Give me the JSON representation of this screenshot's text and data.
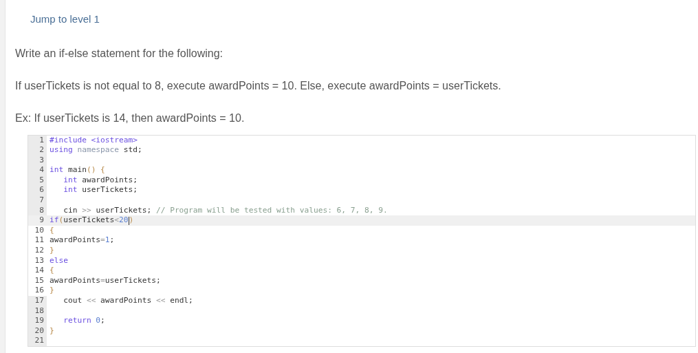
{
  "jump_link": "Jump to level 1",
  "instructions": [
    "Write an if-else statement for the following:",
    "If userTickets is not equal to 8, execute awardPoints = 10. Else, execute awardPoints = userTickets.",
    "Ex: If userTickets is 14, then awardPoints = 10."
  ],
  "code_editor": {
    "lines": [
      {
        "number": "1",
        "editable": false,
        "current": false,
        "tokens": [
          {
            "kind": "meta",
            "text": "#include <iostream>"
          }
        ]
      },
      {
        "number": "2",
        "editable": false,
        "current": false,
        "tokens": [
          {
            "kind": "keyword",
            "text": "using "
          },
          {
            "kind": "ns",
            "text": "namespace"
          },
          {
            "kind": "plain",
            "text": " std;"
          }
        ]
      },
      {
        "number": "3",
        "editable": false,
        "current": false
      },
      {
        "number": "4",
        "editable": false,
        "current": false,
        "tokens": [
          {
            "kind": "keyword",
            "text": "int"
          },
          {
            "kind": "plain",
            "text": " main"
          },
          {
            "kind": "bracket",
            "text": "() {"
          }
        ]
      },
      {
        "number": "5",
        "editable": false,
        "current": false,
        "tokens": [
          {
            "kind": "keyword",
            "text": "   int"
          },
          {
            "kind": "plain",
            "text": " awardPoints;"
          }
        ]
      },
      {
        "number": "6",
        "editable": false,
        "current": false,
        "tokens": [
          {
            "kind": "keyword",
            "text": "   int"
          },
          {
            "kind": "plain",
            "text": " userTickets;"
          }
        ]
      },
      {
        "number": "7",
        "editable": false,
        "current": false
      },
      {
        "number": "8",
        "editable": false,
        "current": false,
        "tokens": [
          {
            "kind": "plain",
            "text": "   cin "
          },
          {
            "kind": "operator",
            "text": ">>"
          },
          {
            "kind": "plain",
            "text": " userTickets; "
          },
          {
            "kind": "comment",
            "text": "// Program will be tested with values: 6, 7, 8, 9."
          }
        ]
      },
      {
        "number": "9",
        "editable": true,
        "current": true,
        "tokens": [
          {
            "kind": "keyword",
            "text": "if"
          },
          {
            "kind": "bracket",
            "text": "("
          },
          {
            "kind": "plain",
            "text": "userTickets"
          },
          {
            "kind": "operator",
            "text": "<"
          },
          {
            "kind": "number",
            "text": "20"
          },
          {
            "kind": "bracket",
            "text": ")"
          }
        ]
      },
      {
        "number": "10",
        "editable": true,
        "current": false,
        "tokens": [
          {
            "kind": "bracket",
            "text": "{"
          }
        ]
      },
      {
        "number": "11",
        "editable": true,
        "current": false,
        "tokens": [
          {
            "kind": "plain",
            "text": "awardPoints"
          },
          {
            "kind": "operator",
            "text": "="
          },
          {
            "kind": "number",
            "text": "1"
          },
          {
            "kind": "plain",
            "text": ";"
          }
        ]
      },
      {
        "number": "12",
        "editable": true,
        "current": false,
        "tokens": [
          {
            "kind": "bracket",
            "text": "}"
          }
        ]
      },
      {
        "number": "13",
        "editable": true,
        "current": false,
        "tokens": [
          {
            "kind": "keyword",
            "text": "else"
          }
        ]
      },
      {
        "number": "14",
        "editable": true,
        "current": false,
        "tokens": [
          {
            "kind": "bracket",
            "text": "{"
          }
        ]
      },
      {
        "number": "15",
        "editable": true,
        "current": false,
        "tokens": [
          {
            "kind": "plain",
            "text": "awardPoints"
          },
          {
            "kind": "operator",
            "text": "="
          },
          {
            "kind": "plain",
            "text": "userTickets;"
          }
        ]
      },
      {
        "number": "16",
        "editable": true,
        "current": false,
        "tokens": [
          {
            "kind": "bracket",
            "text": "}"
          }
        ]
      },
      {
        "number": "17",
        "editable": false,
        "current": false,
        "tokens": [
          {
            "kind": "plain",
            "text": "   cout "
          },
          {
            "kind": "operator",
            "text": "<<"
          },
          {
            "kind": "plain",
            "text": " awardPoints "
          },
          {
            "kind": "operator",
            "text": "<<"
          },
          {
            "kind": "plain",
            "text": " endl;"
          }
        ]
      },
      {
        "number": "18",
        "editable": false,
        "current": false
      },
      {
        "number": "19",
        "editable": false,
        "current": false,
        "tokens": [
          {
            "kind": "keyword",
            "text": "   return"
          },
          {
            "kind": "number",
            "text": " 0"
          },
          {
            "kind": "plain",
            "text": ";"
          }
        ]
      },
      {
        "number": "20",
        "editable": false,
        "current": false,
        "tokens": [
          {
            "kind": "bracket",
            "text": "}"
          }
        ]
      },
      {
        "number": "21",
        "editable": false,
        "current": false
      }
    ]
  }
}
